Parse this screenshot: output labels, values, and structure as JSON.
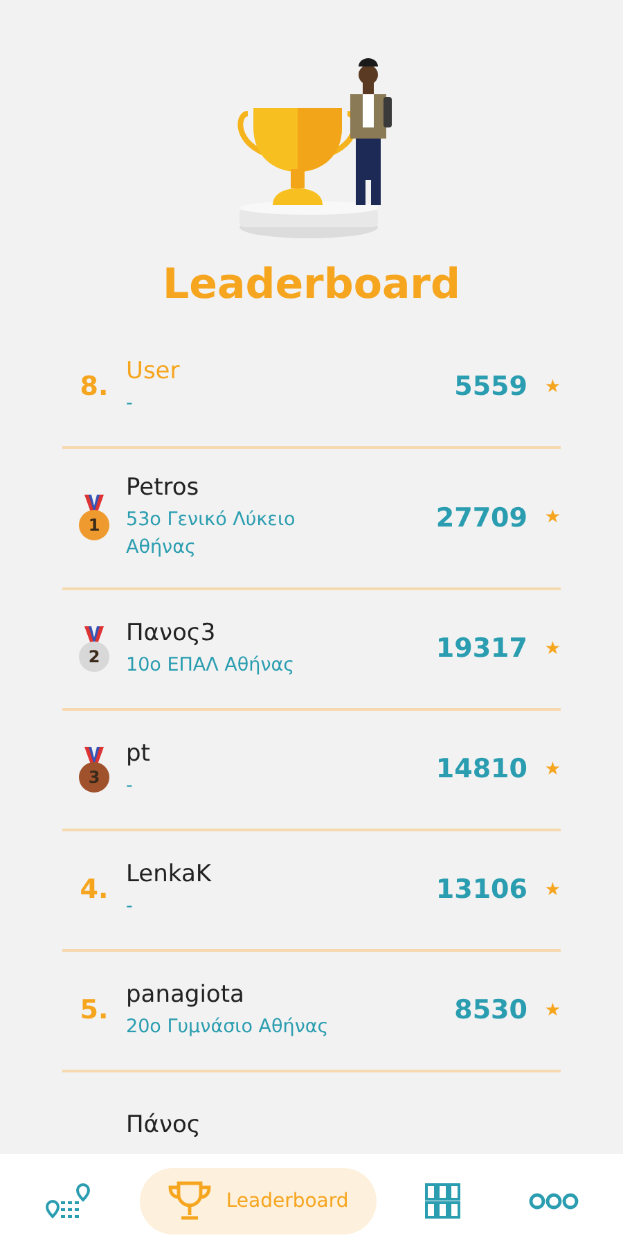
{
  "header": {
    "title": "Leaderboard"
  },
  "rows": [
    {
      "kind": "rank",
      "rank": "8.",
      "name": "User",
      "school": "-",
      "score": "5559",
      "star": "★",
      "highlighted": true
    },
    {
      "kind": "medal",
      "rank": "1",
      "color": "#ef9a2e",
      "name": "Petros",
      "school": "53ο Γενικό Λύκειο Αθήνας",
      "score": "27709",
      "star": "★",
      "highlighted": false
    },
    {
      "kind": "medal",
      "rank": "2",
      "color": "#d8d8d8",
      "name": "Πανος3",
      "school": "10ο ΕΠΑΛ Αθήνας",
      "score": "19317",
      "star": "★",
      "highlighted": false
    },
    {
      "kind": "medal",
      "rank": "3",
      "color": "#a0522d",
      "name": "pt",
      "school": "-",
      "score": "14810",
      "star": "★",
      "highlighted": false
    },
    {
      "kind": "rank",
      "rank": "4.",
      "name": "LenkaK",
      "school": "-",
      "score": "13106",
      "star": "★",
      "highlighted": false
    },
    {
      "kind": "rank",
      "rank": "5.",
      "name": "panagiota",
      "school": "20ο Γυμνάσιο Αθήνας",
      "score": "8530",
      "star": "★",
      "highlighted": false
    },
    {
      "kind": "partial",
      "name": "Πάνος"
    }
  ],
  "nav": [
    {
      "kind": "route",
      "selected": false
    },
    {
      "kind": "trophy",
      "label": "Leaderboard",
      "selected": true
    },
    {
      "kind": "grid",
      "selected": false
    },
    {
      "kind": "more",
      "selected": false
    }
  ]
}
